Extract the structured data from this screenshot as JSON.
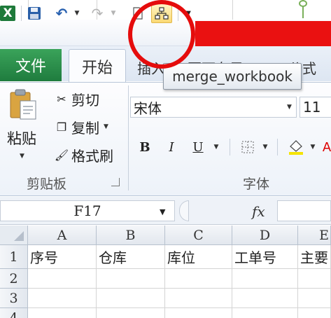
{
  "quick_access": {
    "excel_letter": "X",
    "merge_tooltip": "merge_workbook"
  },
  "tabs": {
    "file": "文件",
    "home": "开始",
    "insert": "插入",
    "page_layout": "页面布局",
    "formulas": "公式"
  },
  "clipboard": {
    "paste": "粘贴",
    "cut": "剪切",
    "copy": "复制",
    "format_painter": "格式刷",
    "group_label": "剪贴板"
  },
  "font": {
    "name": "宋体",
    "size": "11",
    "group_label": "字体",
    "bold": "B",
    "italic": "I",
    "underline": "U",
    "font_color_letter": "A"
  },
  "formula_bar": {
    "name_box": "F17",
    "fx": "fx",
    "value": ""
  },
  "sheet": {
    "columns": [
      "A",
      "B",
      "C",
      "D",
      "E"
    ],
    "rows": [
      "1",
      "2",
      "3",
      "4"
    ],
    "row1": [
      "序号",
      "仓库",
      "库位",
      "工单号",
      "主要"
    ]
  },
  "colors": {
    "file_tab": "#1f7c3e",
    "highlight_circle": "#e50c0c",
    "red_banner": "#ea1111"
  }
}
